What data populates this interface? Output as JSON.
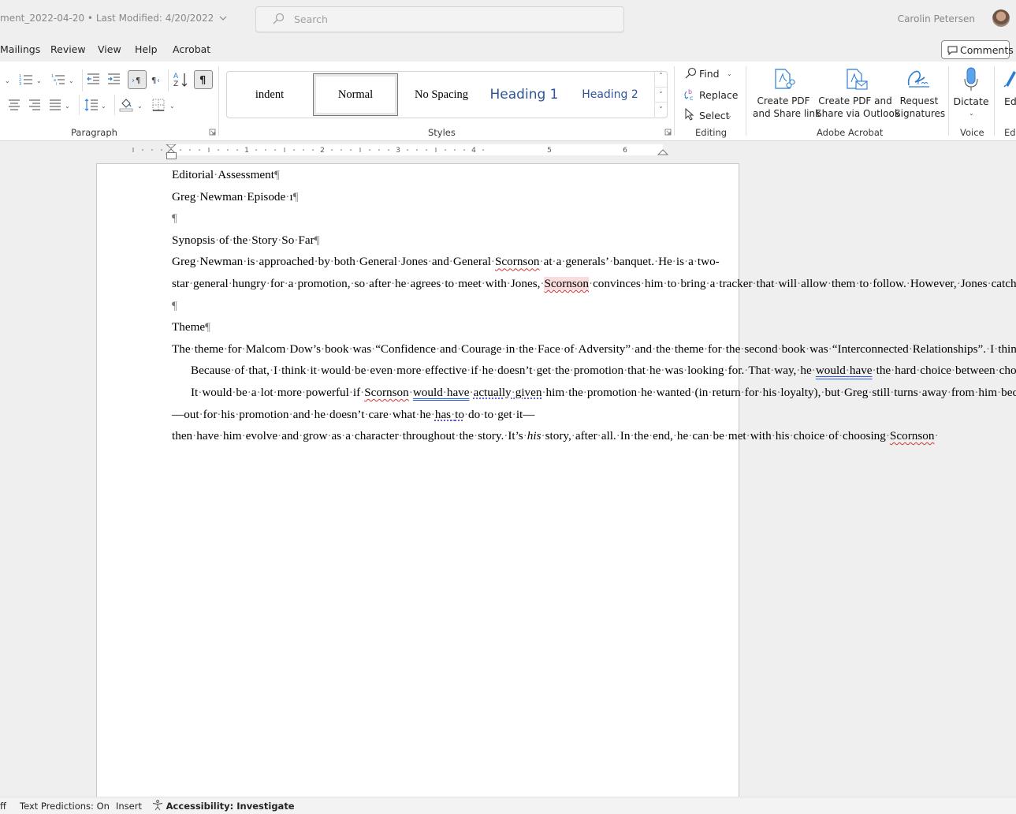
{
  "titlebar": {
    "doc_title": "ment_2022-04-20  •  Last Modified: 4/20/2022",
    "search_placeholder": "Search",
    "user_name": "Carolin Petersen"
  },
  "tabs": [
    {
      "label": "Mailings"
    },
    {
      "label": "Review"
    },
    {
      "label": "View"
    },
    {
      "label": "Help"
    },
    {
      "label": "Acrobat"
    }
  ],
  "comments_label": "Comments",
  "ribbon": {
    "paragraph_label": "Paragraph",
    "styles_label": "Styles",
    "editing_label": "Editing",
    "acrobat_label": "Adobe Acrobat",
    "voice_label": "Voice",
    "editor_label": "Edi",
    "styles": [
      {
        "name": "indent"
      },
      {
        "name": "Normal",
        "selected": true
      },
      {
        "name": "No Spacing"
      },
      {
        "name": "Heading 1"
      },
      {
        "name": "Heading 2"
      }
    ],
    "editing": {
      "find": "Find",
      "replace": "Replace",
      "select": "Select"
    },
    "acrobat": {
      "create_pdf_share_link": [
        "Create PDF",
        "and Share link"
      ],
      "create_pdf_outlook": [
        "Create PDF and",
        "Share via Outlook"
      ],
      "request_signatures": [
        "Request",
        "Signatures"
      ]
    },
    "dictate": "Dictate",
    "editor_partial": "Edi",
    "accent_color": "#2b7cd3"
  },
  "ruler": {
    "numbers": [
      "1",
      "2",
      "3",
      "4",
      "5",
      "6"
    ]
  },
  "document": {
    "paragraphs": [
      {
        "id": "p1",
        "text": "Editorial·Assessment¶"
      },
      {
        "id": "p2",
        "text": "Greg·Newman·Episode·ı¶"
      },
      {
        "id": "p3",
        "text": "¶"
      },
      {
        "id": "p4",
        "text": "Synopsis·of·the·Story·So·Far¶"
      },
      {
        "id": "p5",
        "text": "Greg·Newman·is·approached·by·both·General·Jones·and·General·Scornson·at·a·generals’·banquet.·He·is·a·two-star·general·hungry·for·a·promotion,·so·after·he·agrees·to·meet·with·Jones,·Scornson·convinces·him·to·bring·a·tracker·that·will·allow·them·to·follow.·However,·Jones·catches·onto·his·deceit,·and·Newman·learns·his·lesson·while·Scornson·is·misdirected·and·detained·in·Canada.·Newman·is·placed·in·charge·of·the·earth·base·while·Jones·is·in·space.·Over·the·next·few·months,·he·has·video·calls·with·Jones,·and·he·has·meetings·with·the·president.·General·Scornson·is·later·released·from·prison·and·resumes·his·plan·of·discovering·Jones’s·base·and·destroying·the·aliens.¶"
      },
      {
        "id": "p6",
        "text": "¶"
      },
      {
        "id": "p7",
        "text": "Theme¶"
      },
      {
        "id": "p8",
        "text": "The·theme·for·Malcom·Dow’s·book·was·“Confidence·and·Courage·in·the·Face·of·Adversity”·and·the·theme·for·the·second·book·was·“Interconnected·Relationships”.·I·think·the·main·theme·for·this·book·would·be·“Doing·the·Right·Thing·Even·Though·It’s·Hard”·because·that’s·what·Greg·learns·to·do·in·this·book·by·choosing·General·Jones’s·side.¶"
      },
      {
        "id": "p9",
        "text": "Because·of·that,·I·think·it·would·be·even·more·effective·if·he·doesn’t·get·the·promotion·that·he·was·looking·for.·That·way,·he·would·have·the·hard·choice·between·choosing·Scornson·for·the·easy·promotion·or·doing·the·right·thing·but·putting·aside·his·own·personal·goals.·In·the·book·now,·he·first·chooses·Scornson,·but·gets·caught·and·embarrassed.·He·learns·that·Scornson·wouldn’t·have·given·him·the·promotion·anyway,·and·then·he·gets·promoted·right·away·by·Jones.·It·feels·too·easy.·There·isn’t·any·loss·over·doing·the·right·thing·because·he’s·rewarded·anyway.·He·didn’t·really·learn·anything·aside·from·the·fact·that·Scornson·can’t·be·trusted.¶"
      },
      {
        "id": "p10",
        "text": "It·would·be·a·lot·more·powerful·if·Scornson·would·have·actually·given·him·the·promotion·he·wanted·(in·return·for·his·loyalty),·but·Greg·still·turns·away·from·him·because·he·realizes·that·it’s·wrong.·If·he’s·“undecided”,·you·can·start·with·him·being·selfish—out·for·his·promotion·and·he·doesn’t·care·what·he·has·to·do·to·get·it—then·have·him·evolve·and·grow·as·a·character·throughout·the·story.·It’s·his·story,·after·all.·In·the·end,·he·can·be·met·with·his·choice·of·choosing·Scornson·"
      }
    ]
  },
  "statusbar": {
    "partial_left": "ff",
    "text_predictions": "Text Predictions: On",
    "insert_mode": "Insert",
    "accessibility": "Accessibility: Investigate"
  }
}
